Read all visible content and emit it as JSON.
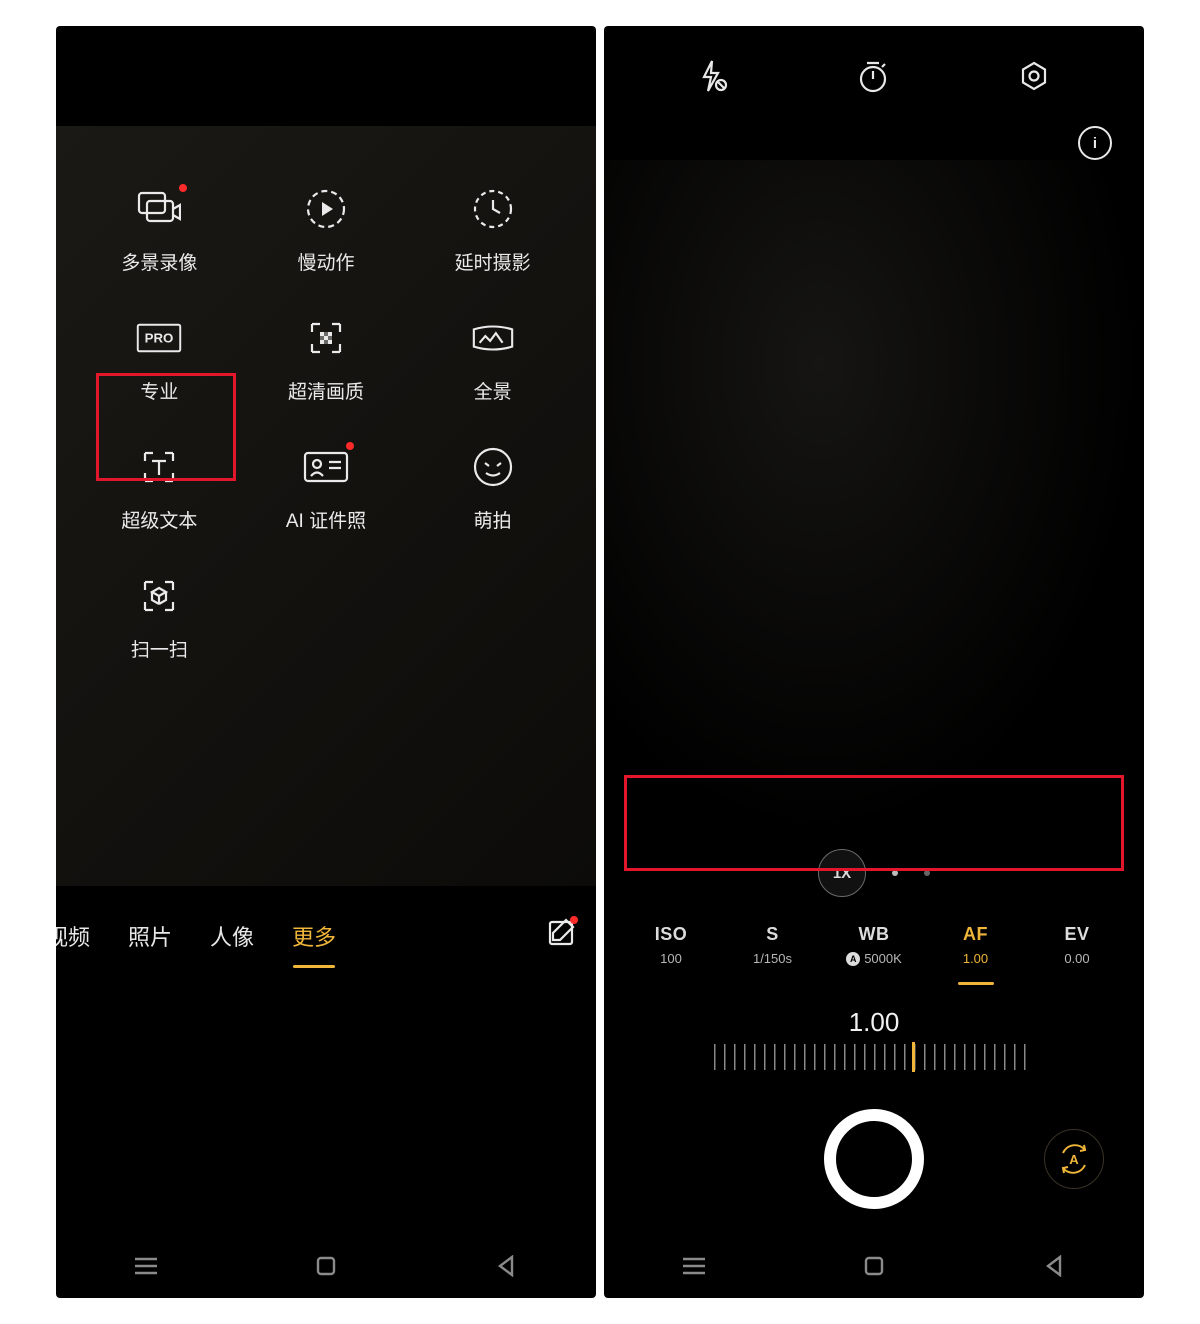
{
  "left": {
    "modes": [
      {
        "id": "multi-record",
        "label": "多景录像",
        "dot": true
      },
      {
        "id": "slowmo",
        "label": "慢动作",
        "dot": false
      },
      {
        "id": "timelapse",
        "label": "延时摄影",
        "dot": false
      },
      {
        "id": "pro",
        "label": "专业",
        "dot": false,
        "badge": "PRO"
      },
      {
        "id": "hires",
        "label": "超清画质",
        "dot": false
      },
      {
        "id": "pano",
        "label": "全景",
        "dot": false
      },
      {
        "id": "supertext",
        "label": "超级文本",
        "dot": false
      },
      {
        "id": "idphoto",
        "label": "AI 证件照",
        "dot": true
      },
      {
        "id": "cutecam",
        "label": "萌拍",
        "dot": false
      },
      {
        "id": "scan",
        "label": "扫一扫",
        "dot": false
      }
    ],
    "tabs": {
      "video": "视频",
      "photo": "照片",
      "portrait": "人像",
      "more": "更多"
    }
  },
  "right": {
    "zoom": "1X",
    "params": [
      {
        "id": "iso",
        "name": "ISO",
        "val": "100",
        "auto": false,
        "active": false
      },
      {
        "id": "shutter",
        "name": "S",
        "val": "1/150s",
        "auto": false,
        "active": false
      },
      {
        "id": "wb",
        "name": "WB",
        "val": "5000K",
        "auto": true,
        "active": false
      },
      {
        "id": "af",
        "name": "AF",
        "val": "1.00",
        "auto": false,
        "active": true
      },
      {
        "id": "ev",
        "name": "EV",
        "val": "0.00",
        "auto": false,
        "active": false
      }
    ],
    "af_big": "1.00",
    "auto_label": "A",
    "info_label": "i"
  }
}
